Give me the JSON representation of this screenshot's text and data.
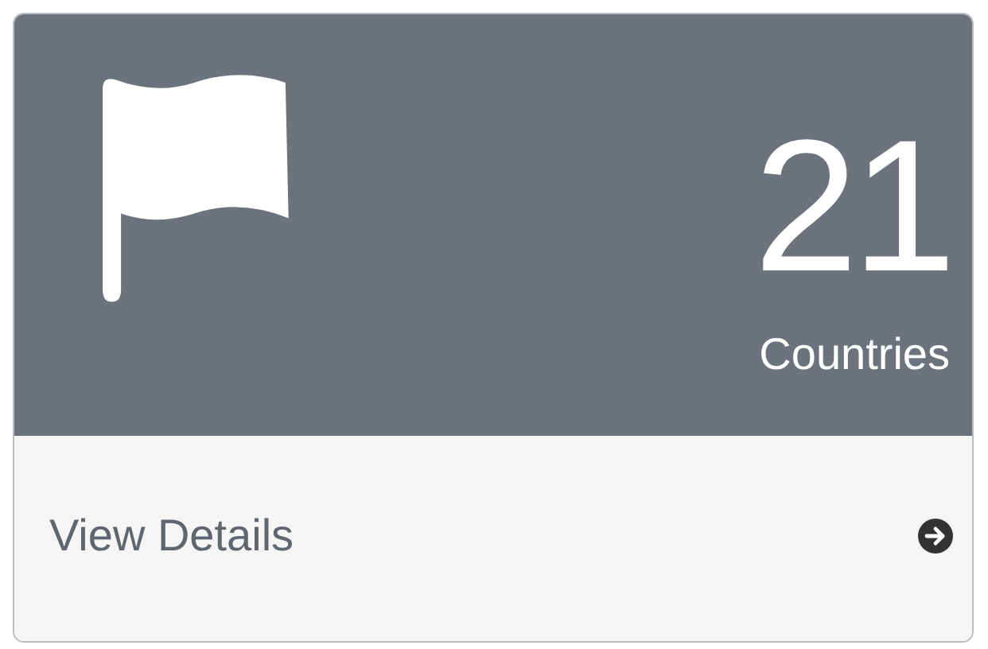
{
  "card": {
    "count": "21",
    "label": "Countries",
    "footer": {
      "link": "View Details"
    }
  }
}
